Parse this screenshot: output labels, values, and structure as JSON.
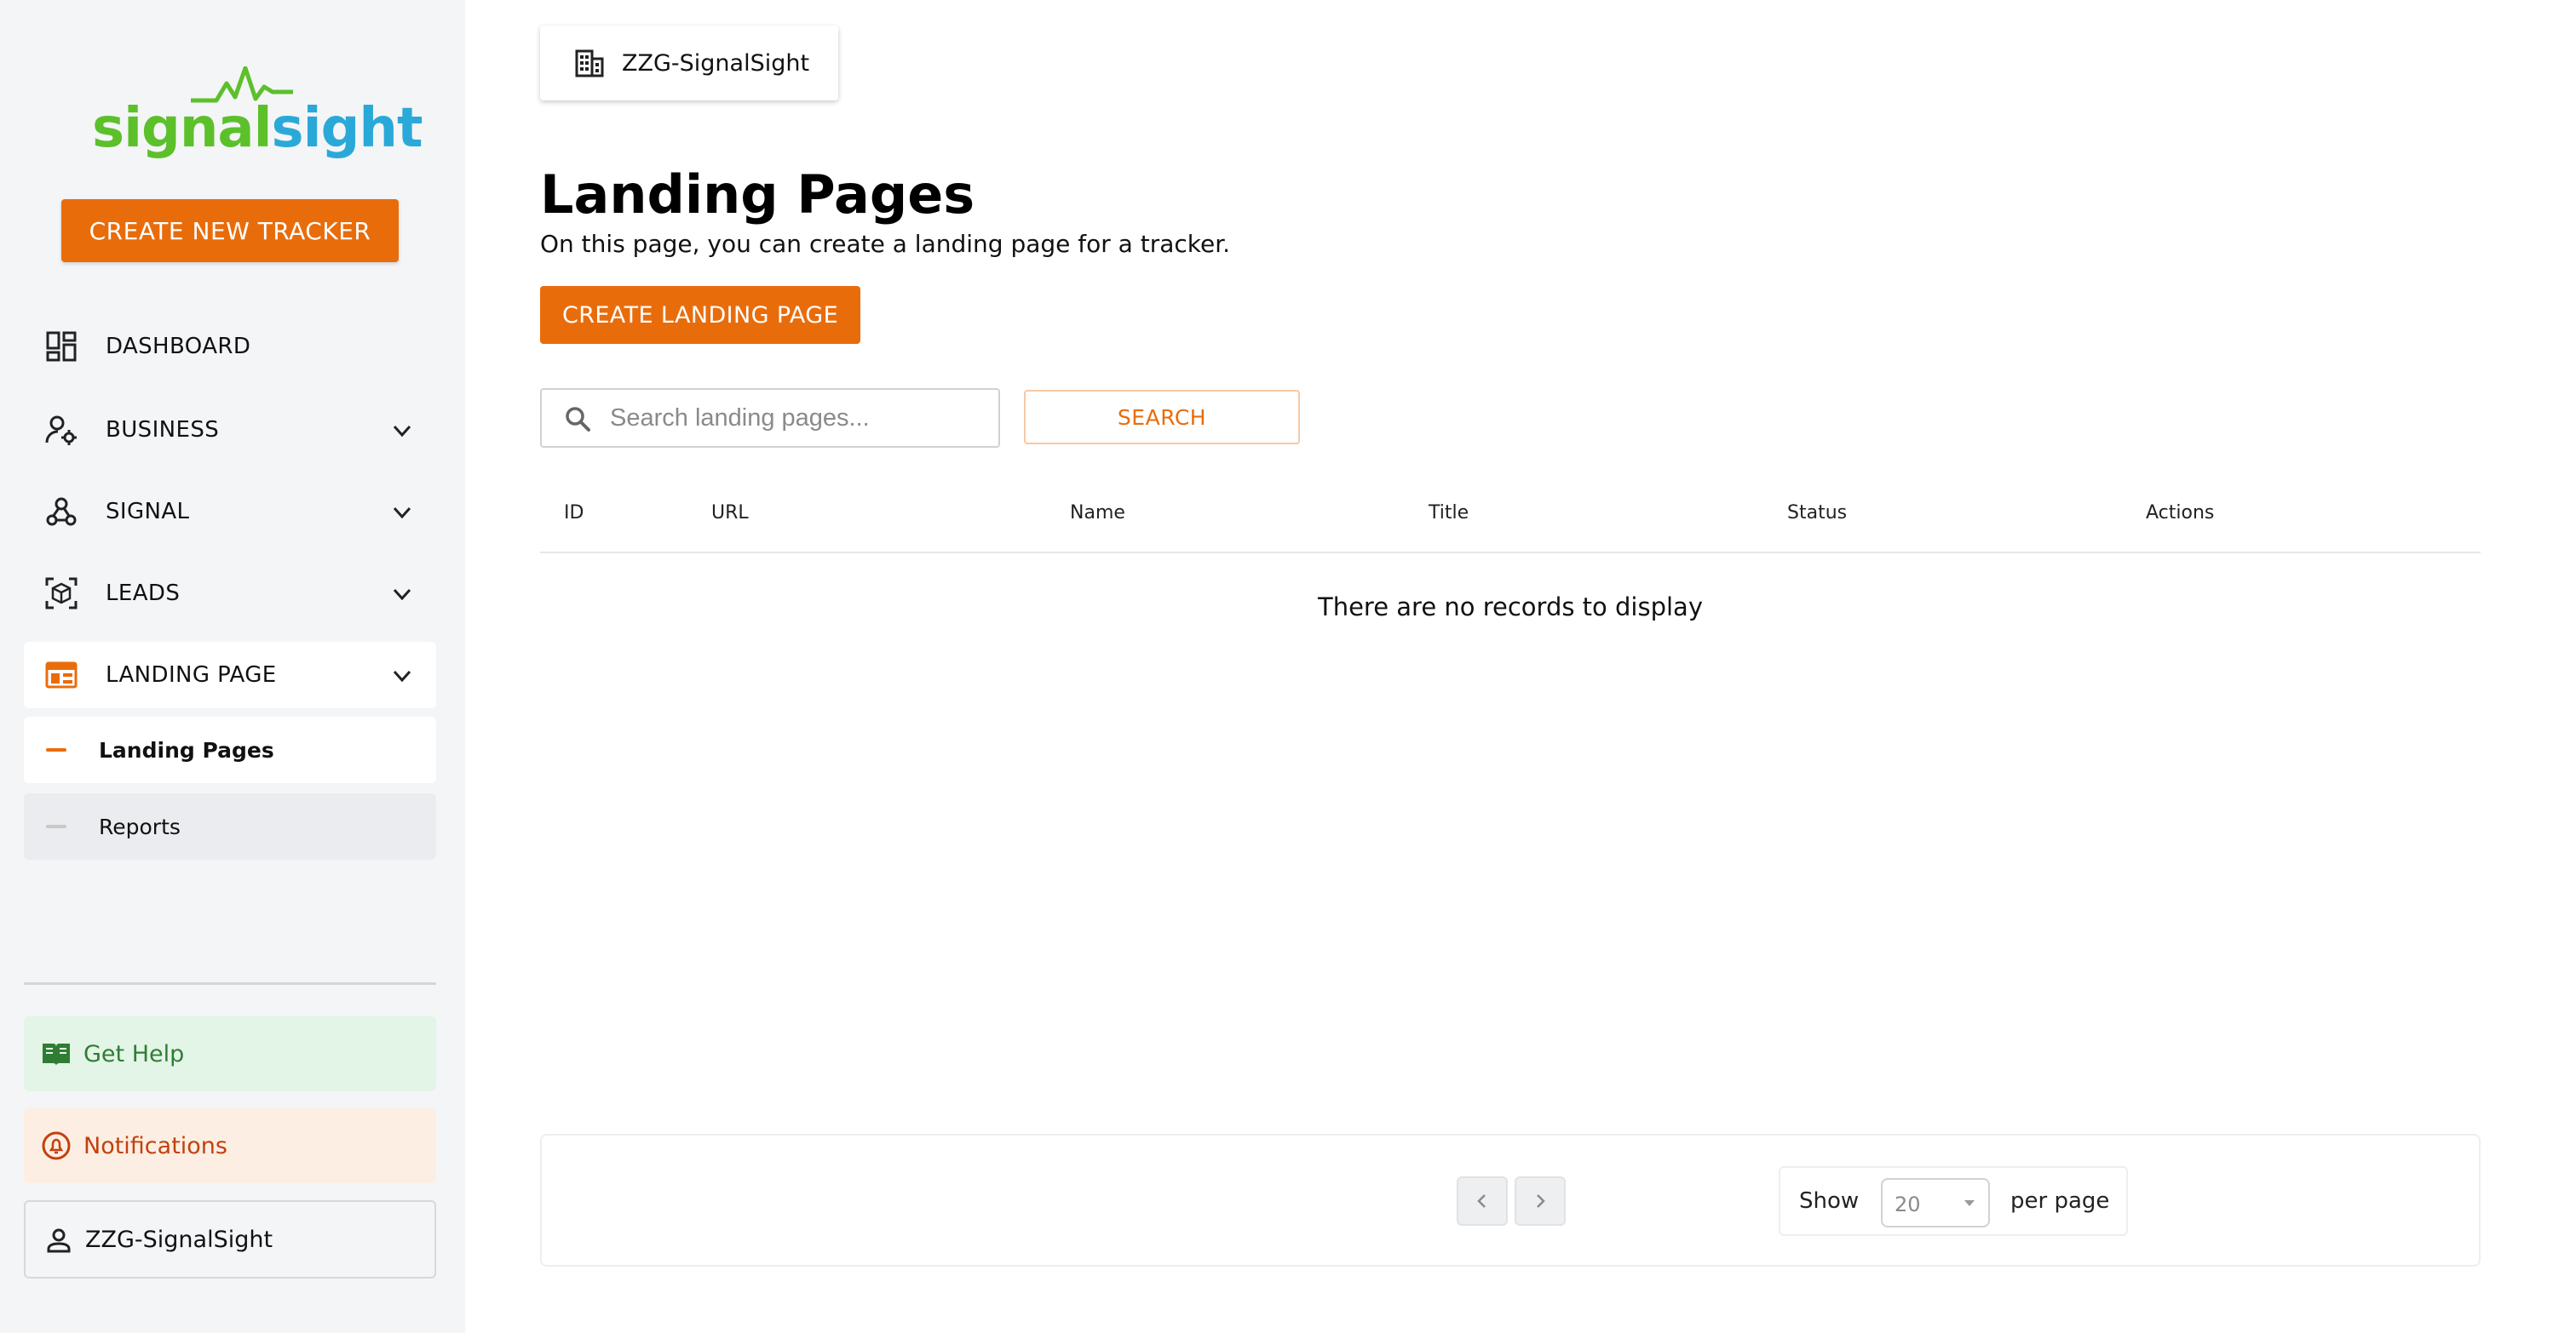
{
  "brand": {
    "part1": "signal",
    "part2": "sight",
    "green": "#5cc02b",
    "blue": "#2aa9d8"
  },
  "accent": "#e96c0b",
  "sidebar": {
    "create_tracker_label": "CREATE NEW TRACKER",
    "items": [
      {
        "label": "DASHBOARD",
        "icon": "dashboard-icon"
      },
      {
        "label": "BUSINESS",
        "icon": "user-gear-icon"
      },
      {
        "label": "SIGNAL",
        "icon": "webhook-icon"
      },
      {
        "label": "LEADS",
        "icon": "scan-cube-icon"
      },
      {
        "label": "LANDING PAGE",
        "icon": "browser-window-icon"
      }
    ],
    "sub_items": [
      {
        "label": "Landing Pages"
      },
      {
        "label": "Reports"
      }
    ],
    "help_label": "Get Help",
    "notifications_label": "Notifications",
    "user_label": "ZZG-SignalSight"
  },
  "org": {
    "name": "ZZG-SignalSight"
  },
  "main": {
    "title": "Landing Pages",
    "description": "On this page, you can create a landing page for a tracker.",
    "create_button_label": "CREATE LANDING PAGE",
    "search": {
      "placeholder": "Search landing pages...",
      "value": "",
      "button_label": "SEARCH"
    },
    "table": {
      "columns": [
        "ID",
        "URL",
        "Name",
        "Title",
        "Status",
        "Actions"
      ],
      "rows": [],
      "empty_message": "There are no records to display"
    },
    "pagination": {
      "show_label": "Show",
      "per_page_value": "20",
      "per_page_label": "per page"
    }
  }
}
